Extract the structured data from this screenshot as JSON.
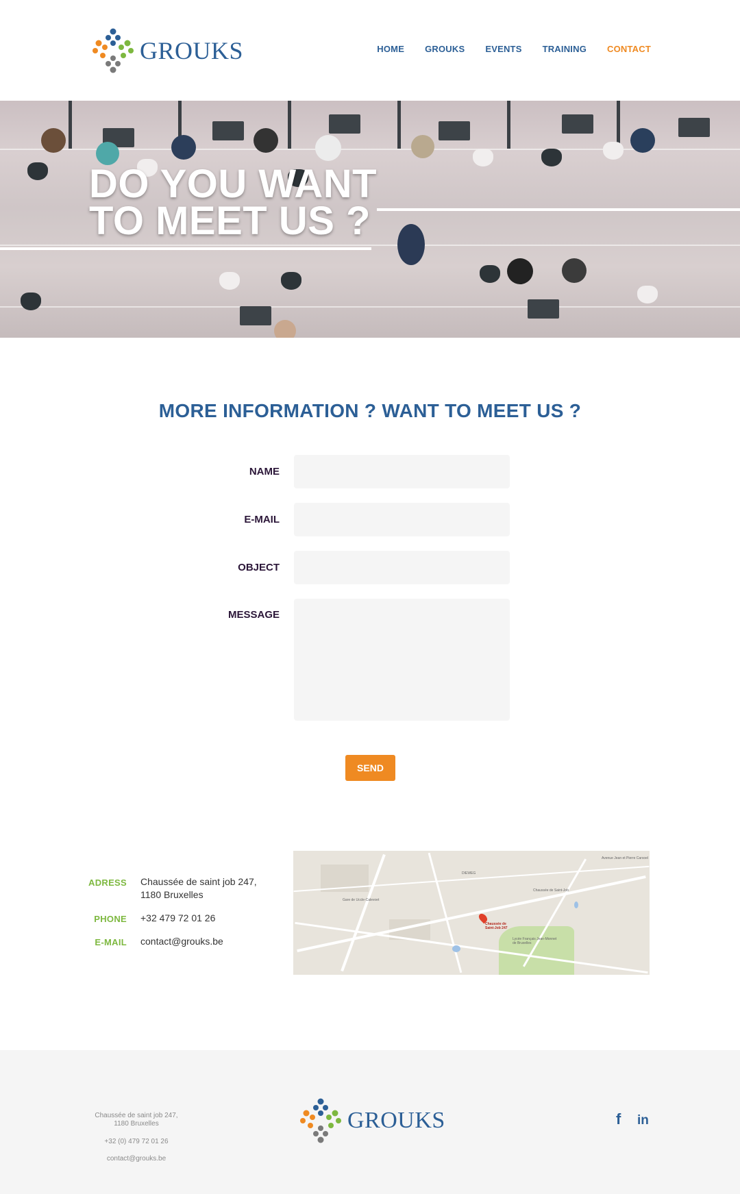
{
  "brand": {
    "name": "GROUKS",
    "primary_color": "#2c5f96",
    "accent_color": "#ef8a22",
    "green_color": "#7db83f"
  },
  "nav": {
    "items": [
      {
        "label": "HOME",
        "active": false
      },
      {
        "label": "GROUKS",
        "active": false
      },
      {
        "label": "EVENTS",
        "active": false
      },
      {
        "label": "TRAINING",
        "active": false
      },
      {
        "label": "CONTACT",
        "active": true
      }
    ]
  },
  "hero": {
    "title_line1": "DO YOU WANT",
    "title_line2": "TO MEET US ?"
  },
  "form": {
    "title": "MORE INFORMATION ? WANT TO MEET US ?",
    "fields": [
      {
        "label": "NAME",
        "value": "",
        "placeholder": ""
      },
      {
        "label": "E-MAIL",
        "value": "",
        "placeholder": ""
      },
      {
        "label": "OBJECT",
        "value": "",
        "placeholder": ""
      },
      {
        "label": "MESSAGE",
        "value": "",
        "placeholder": ""
      }
    ],
    "submit_label": "SEND"
  },
  "contact": {
    "address_label": "ADRESS",
    "address_line1": "Chaussée de saint job 247,",
    "address_line2": "1180 Bruxelles",
    "phone_label": "PHONE",
    "phone": "+32 479 72 01 26",
    "email_label": "E-MAIL",
    "email": "contact@grouks.be"
  },
  "map": {
    "pin_label_line1": "Chaussée de",
    "pin_label_line2": "Saint-Job 247",
    "labels": [
      "Gare de Uccle-Calevoet",
      "Lycée Français Jean-Monnet de Bruxelles",
      "Avenue Jean et Pierre Carsoel",
      "Chaussée de Saint-Job",
      "DIEWEG"
    ]
  },
  "footer": {
    "address_line1": "Chaussée de saint job 247,",
    "address_line2": "1180 Bruxelles",
    "phone": "+32 (0) 479 72 01 26",
    "email": "contact@grouks.be",
    "social": [
      {
        "icon": "facebook-icon",
        "glyph": "f"
      },
      {
        "icon": "linkedin-icon",
        "glyph": "in"
      }
    ]
  }
}
